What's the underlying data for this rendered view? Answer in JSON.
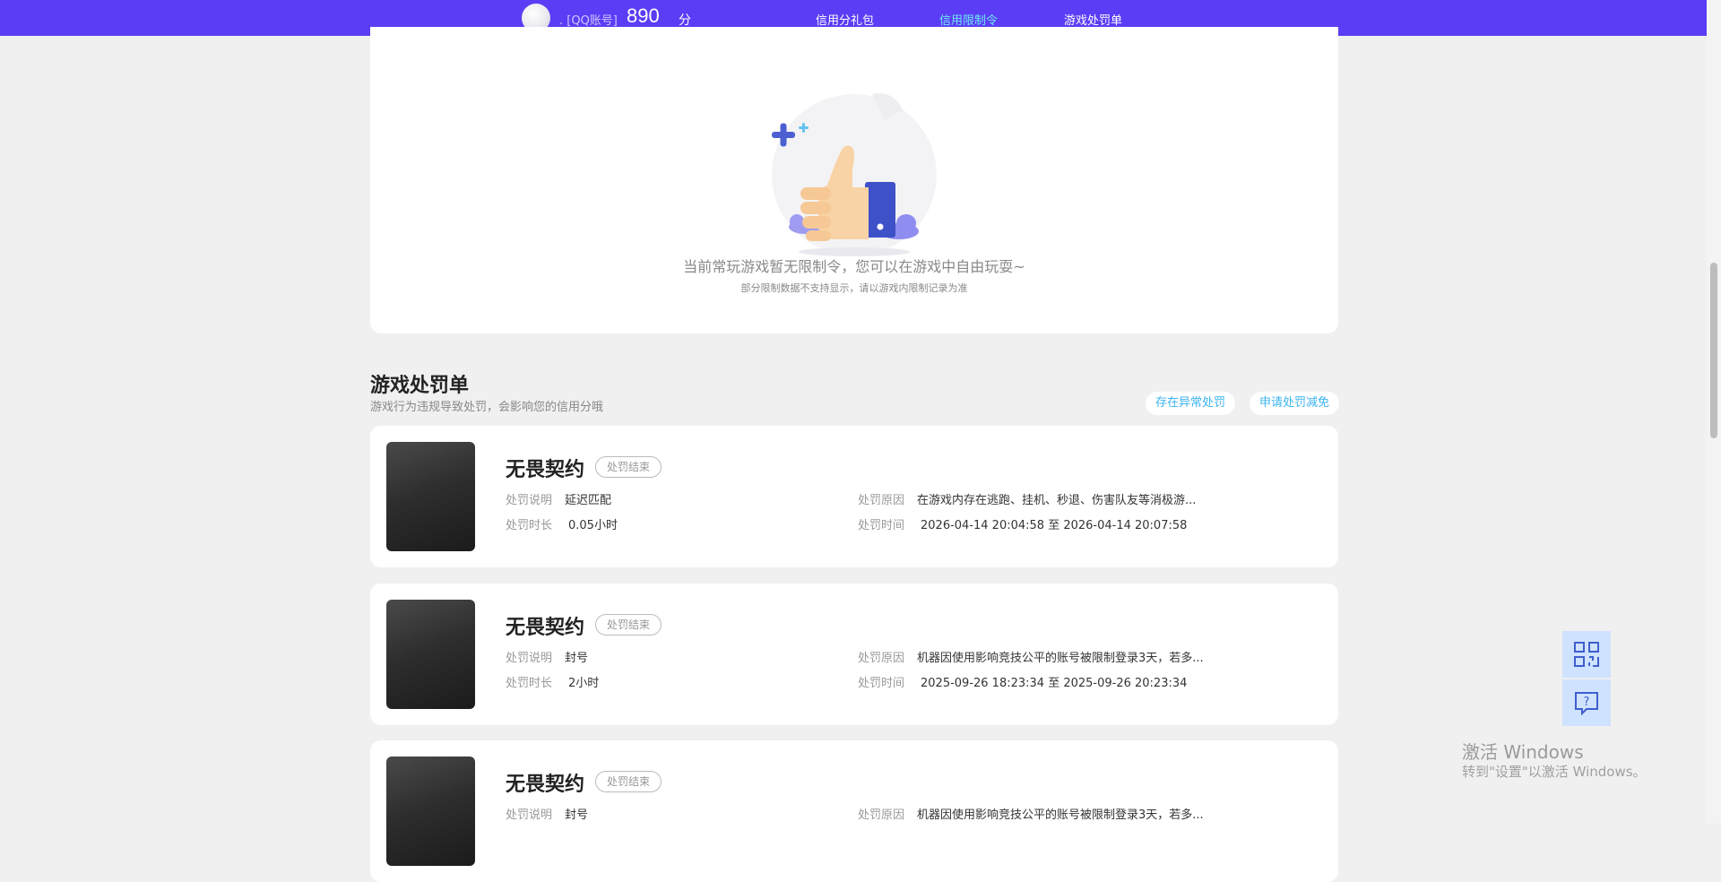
{
  "header": {
    "account_text": ". [QQ账号]",
    "score": "890",
    "score_unit": "分",
    "tabs": [
      {
        "label": "信用分礼包",
        "active": false
      },
      {
        "label": "信用限制令",
        "active": true
      },
      {
        "label": "游戏处罚单",
        "active": false
      }
    ],
    "active_color": "#6ee7f2",
    "bar_color": "#5b3df5"
  },
  "limit_empty": {
    "message": "当前常玩游戏暂无限制令，您可以在游戏中自由玩耍~",
    "note": "部分限制数据不支持显示，请以游戏内限制记录为准",
    "icon": "thumbs-up-illustration"
  },
  "penalties": {
    "title": "游戏处罚单",
    "subtitle": "游戏行为违规导致处罚，会影响您的信用分哦",
    "buttons": {
      "abnormal": "存在异常处罚",
      "appeal": "申请处罚减免"
    },
    "labels": {
      "desc": "处罚说明",
      "duration": "处罚时长",
      "reason": "处罚原因",
      "time": "处罚时间"
    },
    "items": [
      {
        "game": "无畏契约",
        "status": "处罚结束",
        "desc": "延迟匹配",
        "duration": "0.05小时",
        "reason": "在游戏内存在逃跑、挂机、秒退、伤害队友等消极游...",
        "time": "2026-04-14 20:04:58 至 2026-04-14 20:07:58"
      },
      {
        "game": "无畏契约",
        "status": "处罚结束",
        "desc": "封号",
        "duration": "2小时",
        "reason": "机器因使用影响竞技公平的账号被限制登录3天，若多...",
        "time": "2025-09-26 18:23:34 至 2025-09-26 20:23:34"
      },
      {
        "game": "无畏契约",
        "status": "处罚结束",
        "desc": "封号",
        "reason": "机器因使用影响竞技公平的账号被限制登录3天，若多..."
      }
    ]
  },
  "floating": {
    "qr_icon": "qr-code-icon",
    "help_icon": "help-chat-icon"
  },
  "watermark": {
    "title": "激活 Windows",
    "sub": "转到\"设置\"以激活 Windows。"
  }
}
